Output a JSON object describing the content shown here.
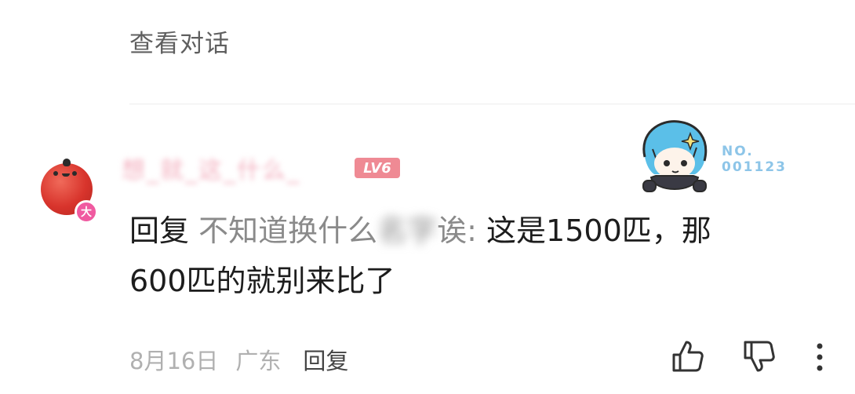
{
  "header": {
    "view_conversation": "查看对话"
  },
  "comment": {
    "avatar_badge": "大",
    "username": "想_就_这_什么_",
    "level": "LV6",
    "reply_prefix": "回复",
    "reply_to_visible_start": "不知道换什么",
    "reply_to_blurred": "名字",
    "reply_to_visible_end": "诶:",
    "content_line1": " 这是1500匹，那",
    "content_line2": "600匹的就别来比了",
    "date": "8月16日",
    "location": "广东",
    "reply_button": "回复",
    "sticker_label_line1": "NO.",
    "sticker_label_line2": "001123"
  },
  "colors": {
    "username": "#f3aebd",
    "level_badge": "#ef8a94",
    "avatar": "#d8342c",
    "badge": "#f05aa0",
    "sticker_text": "#8dc5e8"
  },
  "icons": [
    "apple-avatar-icon",
    "thumbs-up-icon",
    "thumbs-down-icon",
    "more-vertical-icon"
  ]
}
